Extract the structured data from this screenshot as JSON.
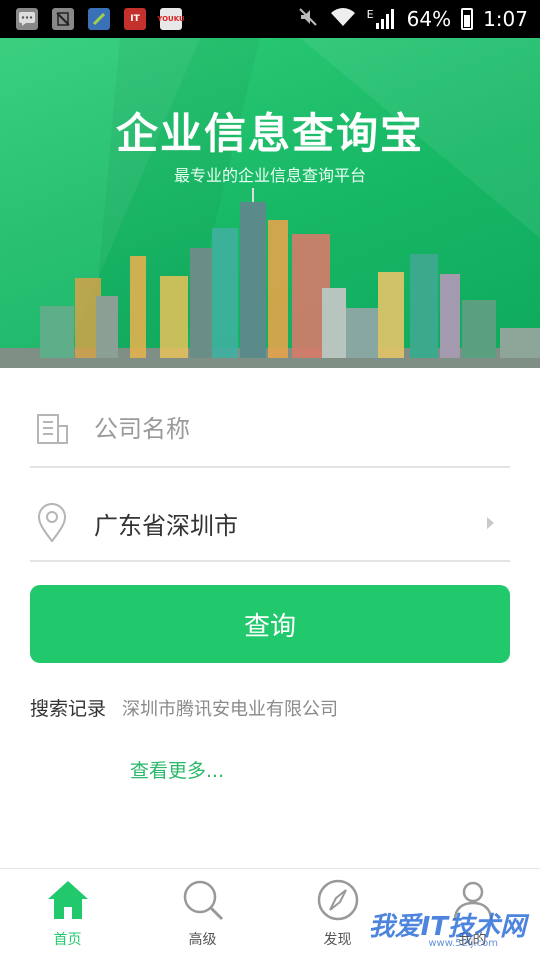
{
  "status_bar": {
    "app_icons": [
      "message-icon",
      "sim-icon",
      "app-icon",
      "ithome-icon",
      "youku-icon"
    ],
    "ithome_label": "IT",
    "youku_label": "YOUKU",
    "network": "E",
    "battery": "64%",
    "time": "1:07"
  },
  "banner": {
    "title": "企业信息查询宝",
    "subtitle": "最专业的企业信息查询平台"
  },
  "search": {
    "company_placeholder": "公司名称",
    "region_value": "广东省深圳市",
    "query_label": "查询"
  },
  "history": {
    "label": "搜索记录",
    "items": [
      "深圳市腾讯安电业有限公司"
    ],
    "more_label": "查看更多..."
  },
  "tabs": [
    {
      "label": "首页",
      "icon": "home-icon",
      "active": true
    },
    {
      "label": "高级",
      "icon": "search-icon",
      "active": false
    },
    {
      "label": "发现",
      "icon": "compass-icon",
      "active": false
    },
    {
      "label": "我的",
      "icon": "user-icon",
      "active": false
    }
  ],
  "watermark": {
    "text": "我爱IT技术网",
    "url": "www.52ij.com"
  },
  "colors": {
    "accent": "#22c96c",
    "banner": "#18b866"
  }
}
